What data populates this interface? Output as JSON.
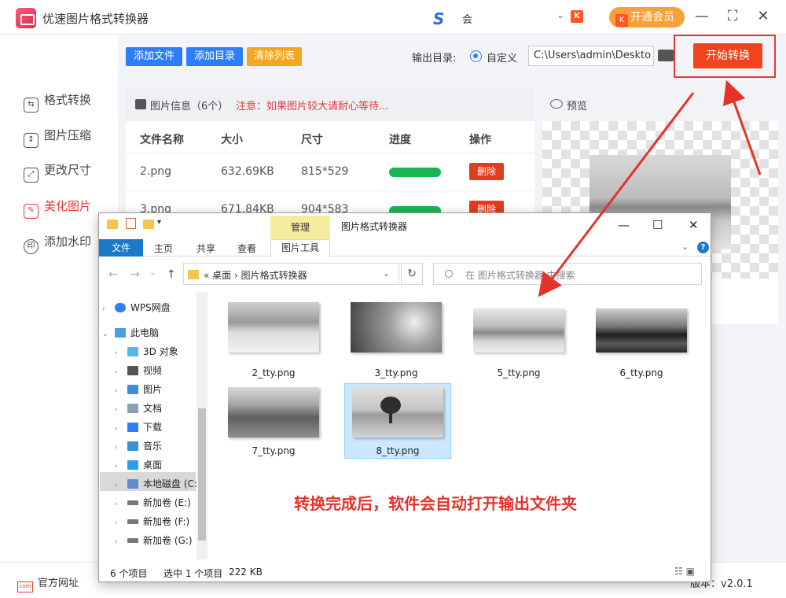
{
  "app": {
    "title": "优速图片格式转换器",
    "user_name": "会",
    "user_logo": "S",
    "vip_label": "开通会员",
    "badge": "K"
  },
  "sidebar": {
    "items": [
      {
        "label": "格式转换",
        "icon": "swap-icon"
      },
      {
        "label": "图片压缩",
        "icon": "compress-icon"
      },
      {
        "label": "更改尺寸",
        "icon": "resize-icon"
      },
      {
        "label": "美化图片",
        "icon": "beautify-icon",
        "active": true
      },
      {
        "label": "添加水印",
        "icon": "watermark-icon"
      }
    ]
  },
  "toolbar": {
    "add_file": "添加文件",
    "add_dir": "添加目录",
    "clear_list": "清除列表",
    "output_label": "输出目录:",
    "radio_label": "自定义",
    "output_path": "C:\\Users\\admin\\Deskto",
    "start": "开始转换",
    "colors": {
      "add_file": "#2d7ff9",
      "add_dir": "#2d7ff9",
      "clear_list": "#f5a623",
      "start": "#f0441e"
    }
  },
  "file_list": {
    "header_label": "图片信息（6个）",
    "notice": "注意：如果图片较大请耐心等待...",
    "columns": [
      "文件名称",
      "大小",
      "尺寸",
      "进度",
      "操作"
    ],
    "rows": [
      {
        "name": "2.png",
        "size": "632.69KB",
        "dims": "815*529",
        "progress": 1.0,
        "action": "删除"
      },
      {
        "name": "3.png",
        "size": "671.84KB",
        "dims": "904*583",
        "progress": 1.0,
        "action": "删除"
      }
    ]
  },
  "preview": {
    "label": "预览"
  },
  "footer": {
    "official_site": "官方网址",
    "version": "版本：v2.0.1"
  },
  "annotation": "转换完成后，软件会自动打开输出文件夹",
  "explorer": {
    "title": "图片格式转换器",
    "manage_tab": "管理",
    "ribbon_tabs": [
      "文件",
      "主页",
      "共享",
      "查看"
    ],
    "tool_tab": "图片工具",
    "address": "«  桌面  ›  图片格式转换器",
    "search_placeholder": "在 图片格式转换器 中搜索",
    "tree": [
      {
        "label": "WPS网盘",
        "icon": "cloud-icon",
        "color": "#2d7ff9"
      },
      {
        "label": "此电脑",
        "icon": "computer-icon",
        "color": "#4a9fe0",
        "expanded": true
      },
      {
        "label": "3D 对象",
        "icon": "3d-objects-icon",
        "color": "#59b7e8"
      },
      {
        "label": "视频",
        "icon": "video-icon",
        "color": "#555555"
      },
      {
        "label": "图片",
        "icon": "pictures-icon",
        "color": "#3c8fd4"
      },
      {
        "label": "文档",
        "icon": "documents-icon",
        "color": "#8aa0b6"
      },
      {
        "label": "下载",
        "icon": "download-icon",
        "color": "#2d7ff9"
      },
      {
        "label": "音乐",
        "icon": "music-icon",
        "color": "#3c8fd4"
      },
      {
        "label": "桌面",
        "icon": "desktop-icon",
        "color": "#2d9cf0"
      },
      {
        "label": "本地磁盘 (C:",
        "icon": "drive-c-icon",
        "color": "#5b8fc7",
        "selected": true
      },
      {
        "label": "新加卷 (E:)",
        "icon": "drive-icon",
        "color": "#777777"
      },
      {
        "label": "新加卷 (F:)",
        "icon": "drive-icon",
        "color": "#777777"
      },
      {
        "label": "新加卷 (G:)",
        "icon": "drive-icon",
        "color": "#777777"
      }
    ],
    "files": [
      {
        "name": "2_tty.png"
      },
      {
        "name": "3_tty.png"
      },
      {
        "name": "5_tty.png"
      },
      {
        "name": "6_tty.png"
      },
      {
        "name": "7_tty.png"
      },
      {
        "name": "8_tty.png",
        "selected": true
      }
    ],
    "status": {
      "count": "6 个项目",
      "selected": "选中 1 个项目",
      "size": "222 KB"
    }
  }
}
